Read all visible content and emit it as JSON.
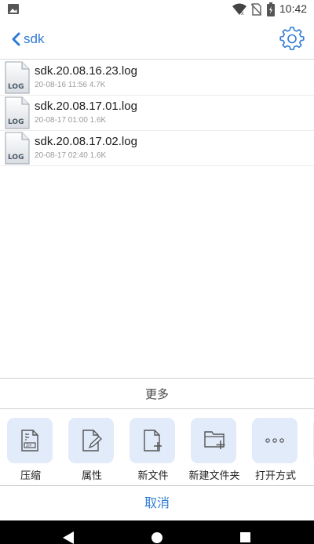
{
  "status_bar": {
    "time": "10:42"
  },
  "toolbar": {
    "title": "sdk"
  },
  "files": [
    {
      "name": "sdk.20.08.16.23.log",
      "meta": "20-08-16 11:56 4.7K",
      "badge": "LOG"
    },
    {
      "name": "sdk.20.08.17.01.log",
      "meta": "20-08-17 01:00 1.6K",
      "badge": "LOG"
    },
    {
      "name": "sdk.20.08.17.02.log",
      "meta": "20-08-17 02:40 1.6K",
      "badge": "LOG"
    }
  ],
  "sheet": {
    "title": "更多",
    "actions": [
      {
        "label": "压缩",
        "icon": "zip-icon"
      },
      {
        "label": "属性",
        "icon": "file-edit-icon"
      },
      {
        "label": "新文件",
        "icon": "new-file-icon"
      },
      {
        "label": "新建文件夹",
        "icon": "new-folder-icon"
      },
      {
        "label": "打开方式",
        "icon": "more-dots-icon"
      }
    ],
    "cancel_label": "取消"
  },
  "colors": {
    "accent": "#2f7bd6",
    "tile": "#e1ebfa",
    "nav_bar": "#000000"
  }
}
